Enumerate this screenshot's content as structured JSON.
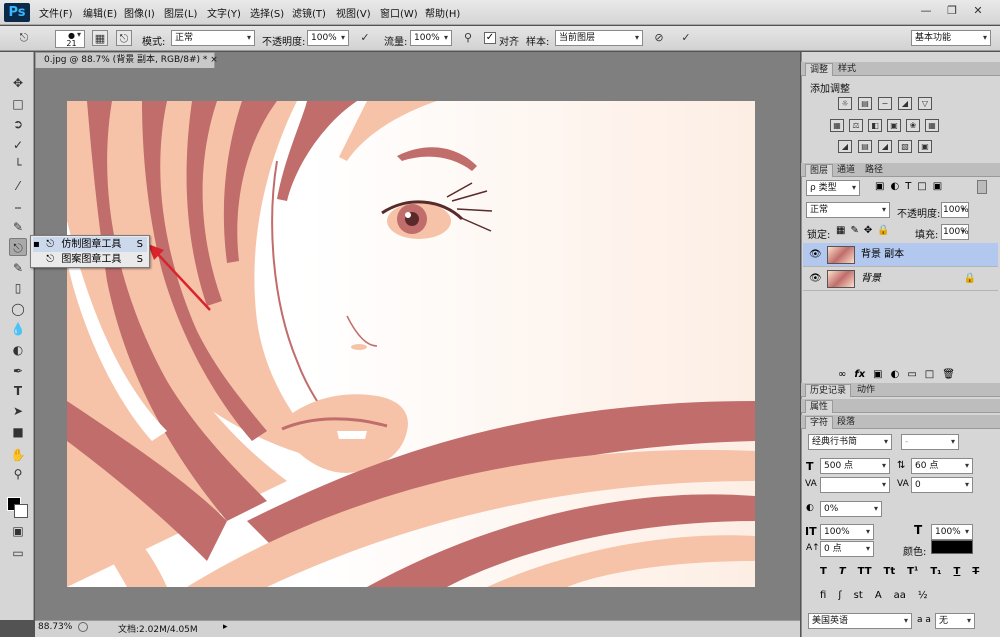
{
  "app": {
    "logo": "Ps"
  },
  "menu": [
    "文件(F)",
    "编辑(E)",
    "图像(I)",
    "图层(L)",
    "文字(Y)",
    "选择(S)",
    "滤镜(T)",
    "视图(V)",
    "窗口(W)",
    "帮助(H)"
  ],
  "window_controls": [
    "—",
    "❐",
    "✕"
  ],
  "options": {
    "brush_size": "21",
    "mode_label": "模式:",
    "mode_value": "正常",
    "opacity_label": "不透明度:",
    "opacity_value": "100%",
    "flow_label": "流量:",
    "flow_value": "100%",
    "align_label": "对齐",
    "sample_label": "样本:",
    "sample_value": "当前图层",
    "workspace": "基本功能"
  },
  "document": {
    "tab_title": "0.jpg @ 88.7% (背景 副本, RGB/8#) *",
    "close": "×"
  },
  "flyout": {
    "items": [
      {
        "label": "仿制图章工具",
        "key": "S"
      },
      {
        "label": "图案图章工具",
        "key": "S"
      }
    ]
  },
  "status": {
    "zoom": "88.73%",
    "doc": "文档:2.02M/4.05M"
  },
  "panels": {
    "adjust_tabs": [
      "调整",
      "样式"
    ],
    "adjust_title": "添加调整",
    "layers_tabs": [
      "图层",
      "通道",
      "路径"
    ],
    "kind_filter": "ρ 类型",
    "blend_mode": "正常",
    "opacity_label": "不透明度:",
    "opacity_value": "100%",
    "lock_label": "锁定:",
    "fill_label": "填充:",
    "fill_value": "100%",
    "layers": [
      {
        "name": "背景 副本",
        "selected": true
      },
      {
        "name": "背景",
        "selected": false,
        "italic": true
      }
    ],
    "history_tabs": [
      "历史记录",
      "动作"
    ],
    "props_tab": "属性",
    "char_tabs": [
      "字符",
      "段落"
    ],
    "font_family": "经典行书简",
    "font_style": "-",
    "font_size": "500 点",
    "leading": "60 点",
    "kerning": "",
    "tracking": "0",
    "tsume": "0%",
    "vscale": "100%",
    "hscale": "100%",
    "baseline": "0 点",
    "color_label": "颜色:",
    "language": "美国英语",
    "aa_label": "a a",
    "aa_value": "无"
  },
  "colors": {
    "accent": "#3c6ec8",
    "hair_dark": "#c06d6b",
    "hair_light": "#f6c3a8",
    "skin": "#ffffff",
    "canvas_bg": "#fdeee4"
  }
}
